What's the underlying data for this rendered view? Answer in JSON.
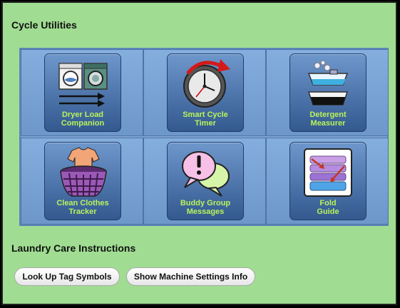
{
  "sections": {
    "cycle_utilities": "Cycle Utilities",
    "care_instructions": "Laundry Care Instructions"
  },
  "tiles": [
    {
      "label": "Dryer Load\nCompanion",
      "icon": "washer-dryer-icon"
    },
    {
      "label": "Smart Cycle\nTimer",
      "icon": "clock-icon"
    },
    {
      "label": "Detergent\nMeasurer",
      "icon": "detergent-cup-icon"
    },
    {
      "label": "Clean Clothes\nTracker",
      "icon": "laundry-basket-icon"
    },
    {
      "label": "Buddy Group\nMessages",
      "icon": "chat-bubbles-icon"
    },
    {
      "label": "Fold\nGuide",
      "icon": "folded-clothes-icon"
    }
  ],
  "buttons": {
    "tag_symbols": "Look Up Tag Symbols",
    "machine_settings": "Show Machine Settings Info"
  },
  "colors": {
    "background": "#a0dd92",
    "tile_label": "#b9f35a",
    "tile_blue": "#33598f"
  }
}
